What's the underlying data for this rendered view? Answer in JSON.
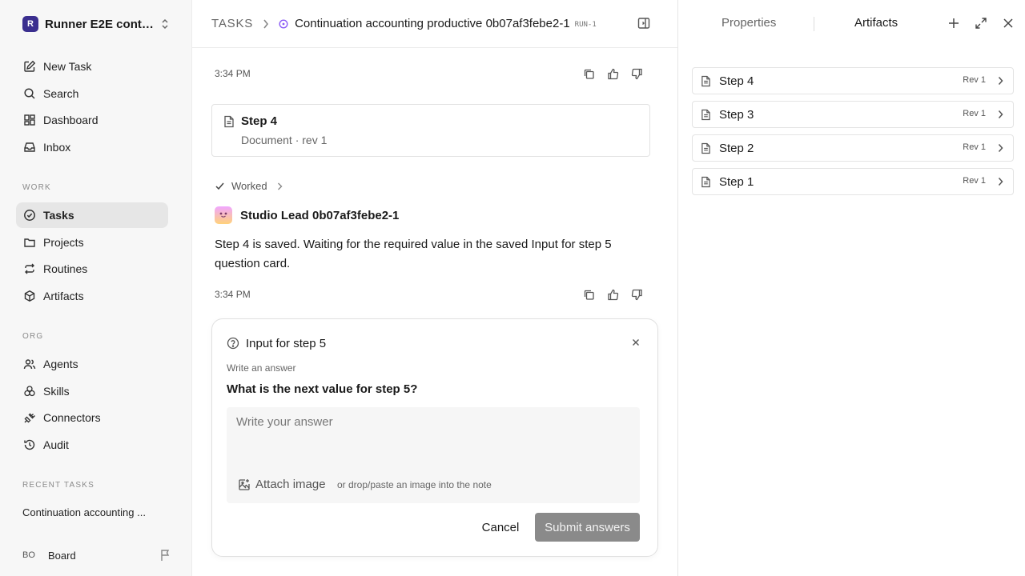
{
  "workspace": {
    "logo_letter": "R",
    "name": "Runner E2E conti..."
  },
  "nav": {
    "new_task": "New Task",
    "search": "Search",
    "dashboard": "Dashboard",
    "inbox": "Inbox",
    "work_label": "WORK",
    "tasks": "Tasks",
    "projects": "Projects",
    "routines": "Routines",
    "artifacts": "Artifacts",
    "org_label": "ORG",
    "agents": "Agents",
    "skills": "Skills",
    "connectors": "Connectors",
    "audit": "Audit",
    "recent_label": "RECENT TASKS",
    "recent_item": "Continuation accounting ..."
  },
  "user": {
    "initials": "BO",
    "name": "Board"
  },
  "header": {
    "root": "TASKS",
    "title": "Continuation accounting productive 0b07af3febe2-1",
    "run_tag": "RUN-1"
  },
  "thread": {
    "time_1": "3:34 PM",
    "doc_title": "Step 4",
    "doc_sub": "Document · rev 1",
    "worked": "Worked",
    "agent_name": "Studio Lead 0b07af3febe2-1",
    "message": "Step 4 is saved. Waiting for the required value in the saved Input for step 5 question card.",
    "time_2": "3:34 PM"
  },
  "question": {
    "title": "Input for step 5",
    "hint": "Write an answer",
    "prompt": "What is the next value for step 5?",
    "placeholder": "Write your answer",
    "attach": "Attach image",
    "attach_hint": "or drop/paste an image into the note",
    "cancel": "Cancel",
    "submit": "Submit answers"
  },
  "right_panel": {
    "tab_properties": "Properties",
    "tab_artifacts": "Artifacts",
    "artifacts": [
      {
        "name": "Step 4",
        "rev": "Rev 1"
      },
      {
        "name": "Step 3",
        "rev": "Rev 1"
      },
      {
        "name": "Step 2",
        "rev": "Rev 1"
      },
      {
        "name": "Step 1",
        "rev": "Rev 1"
      }
    ]
  }
}
